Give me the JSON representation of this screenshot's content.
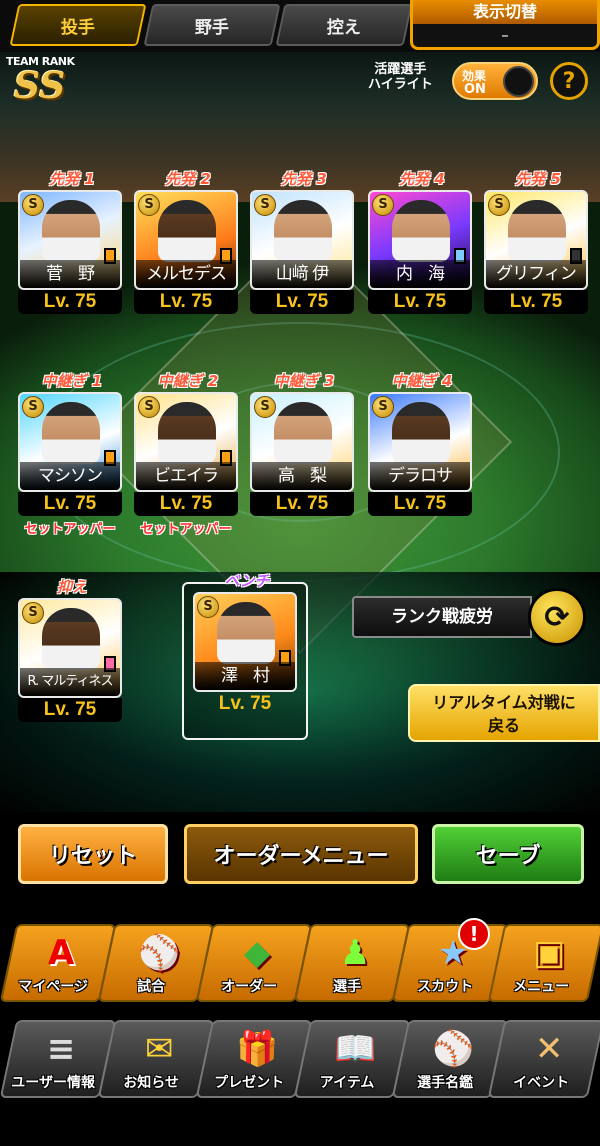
{
  "tabs": [
    {
      "label": "投手",
      "active": true
    },
    {
      "label": "野手",
      "active": false
    },
    {
      "label": "控え",
      "active": false
    }
  ],
  "display_switch": {
    "label": "表示切替",
    "value": "–"
  },
  "team_rank": {
    "label": "TEAM RANK",
    "value": "SS"
  },
  "highlight": {
    "label_line1": "活躍選手",
    "label_line2": "ハイライト",
    "toggle_label": "効果",
    "toggle_state": "ON"
  },
  "help": {
    "label": "?"
  },
  "starters": [
    {
      "role": "先発 1",
      "name": "菅　野",
      "level": "Lv. 75"
    },
    {
      "role": "先発 2",
      "name": "メルセデス",
      "level": "Lv. 75"
    },
    {
      "role": "先発 3",
      "name": "山﨑 伊",
      "level": "Lv. 75"
    },
    {
      "role": "先発 4",
      "name": "内　海",
      "level": "Lv. 75"
    },
    {
      "role": "先発 5",
      "name": "グリフィン",
      "level": "Lv. 75"
    }
  ],
  "relievers": [
    {
      "role": "中継ぎ 1",
      "name": "マシソン",
      "level": "Lv. 75",
      "sub": "セットアッパー"
    },
    {
      "role": "中継ぎ 2",
      "name": "ビエイラ",
      "level": "Lv. 75",
      "sub": "セットアッパー"
    },
    {
      "role": "中継ぎ 3",
      "name": "高　梨",
      "level": "Lv. 75",
      "sub": ""
    },
    {
      "role": "中継ぎ 4",
      "name": "デラロサ",
      "level": "Lv. 75",
      "sub": ""
    }
  ],
  "closer": {
    "role": "抑え",
    "name": "R. マルティネス",
    "level": "Lv. 75"
  },
  "bench": {
    "role": "ベンチ",
    "name": "澤　村",
    "level": "Lv. 75"
  },
  "badge_letter": "S",
  "rank_fatigue": {
    "label": "ランク戦疲労"
  },
  "realtime": {
    "line1": "リアルタイム対戦に",
    "line2": "戻る"
  },
  "actions": {
    "reset": "リセット",
    "order_menu": "オーダーメニュー",
    "save": "セーブ"
  },
  "menu_primary": [
    {
      "label": "マイページ",
      "icon": "A"
    },
    {
      "label": "試合",
      "icon": "⚾"
    },
    {
      "label": "オーダー",
      "icon": "◆"
    },
    {
      "label": "選手",
      "icon": "♟"
    },
    {
      "label": "スカウト",
      "icon": "★"
    },
    {
      "label": "メニュー",
      "icon": "▣"
    }
  ],
  "menu_secondary": [
    {
      "label": "ユーザー情報",
      "icon": "≡"
    },
    {
      "label": "お知らせ",
      "icon": "✉"
    },
    {
      "label": "プレゼント",
      "icon": "🎁"
    },
    {
      "label": "アイテム",
      "icon": "📖"
    },
    {
      "label": "選手名鑑",
      "icon": "⚾"
    },
    {
      "label": "イベント",
      "icon": "✕"
    }
  ],
  "notice_badge": "!",
  "colors": {
    "accent": "#f5b400",
    "lv": "#f7c21b",
    "role": "#ff5a3a",
    "save": "#2ea31f"
  }
}
